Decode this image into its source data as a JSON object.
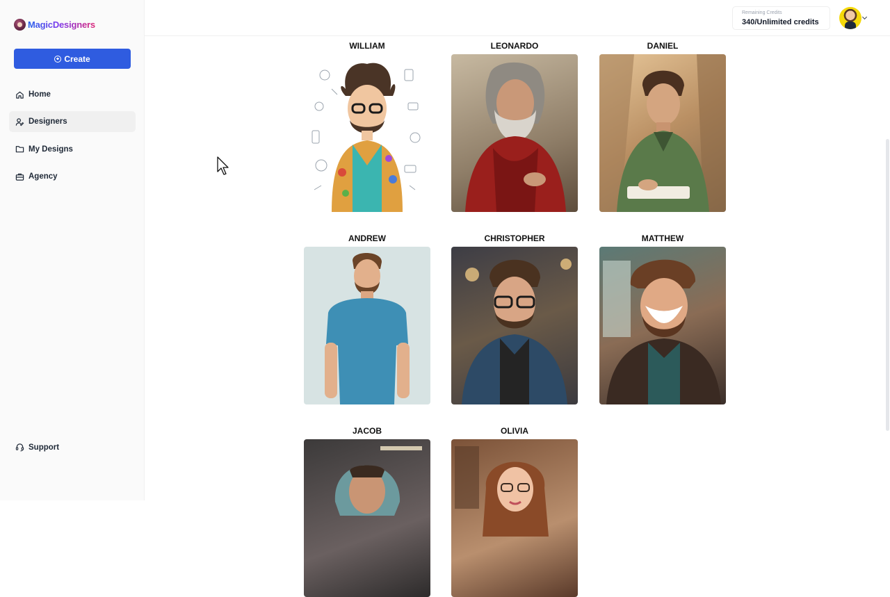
{
  "app": {
    "logo_text": "MagicDesigners"
  },
  "sidebar": {
    "create_label": "Create",
    "items": [
      {
        "label": "Home",
        "icon": "home-icon"
      },
      {
        "label": "Designers",
        "icon": "designers-icon",
        "active": true
      },
      {
        "label": "My Designs",
        "icon": "folder-icon"
      },
      {
        "label": "Agency",
        "icon": "briefcase-icon"
      }
    ],
    "support_label": "Support"
  },
  "header": {
    "credits_label": "Remaining Credits",
    "credits_value": "340/Unlimited credits"
  },
  "designers": [
    {
      "name": "WILLIAM"
    },
    {
      "name": "LEONARDO"
    },
    {
      "name": "DANIEL"
    },
    {
      "name": "ANDREW"
    },
    {
      "name": "CHRISTOPHER"
    },
    {
      "name": "MATTHEW"
    },
    {
      "name": "JACOB"
    },
    {
      "name": "OLIVIA"
    }
  ],
  "colors": {
    "accent": "#2f5ce0",
    "active_nav_bg": "#f0f0f0"
  }
}
